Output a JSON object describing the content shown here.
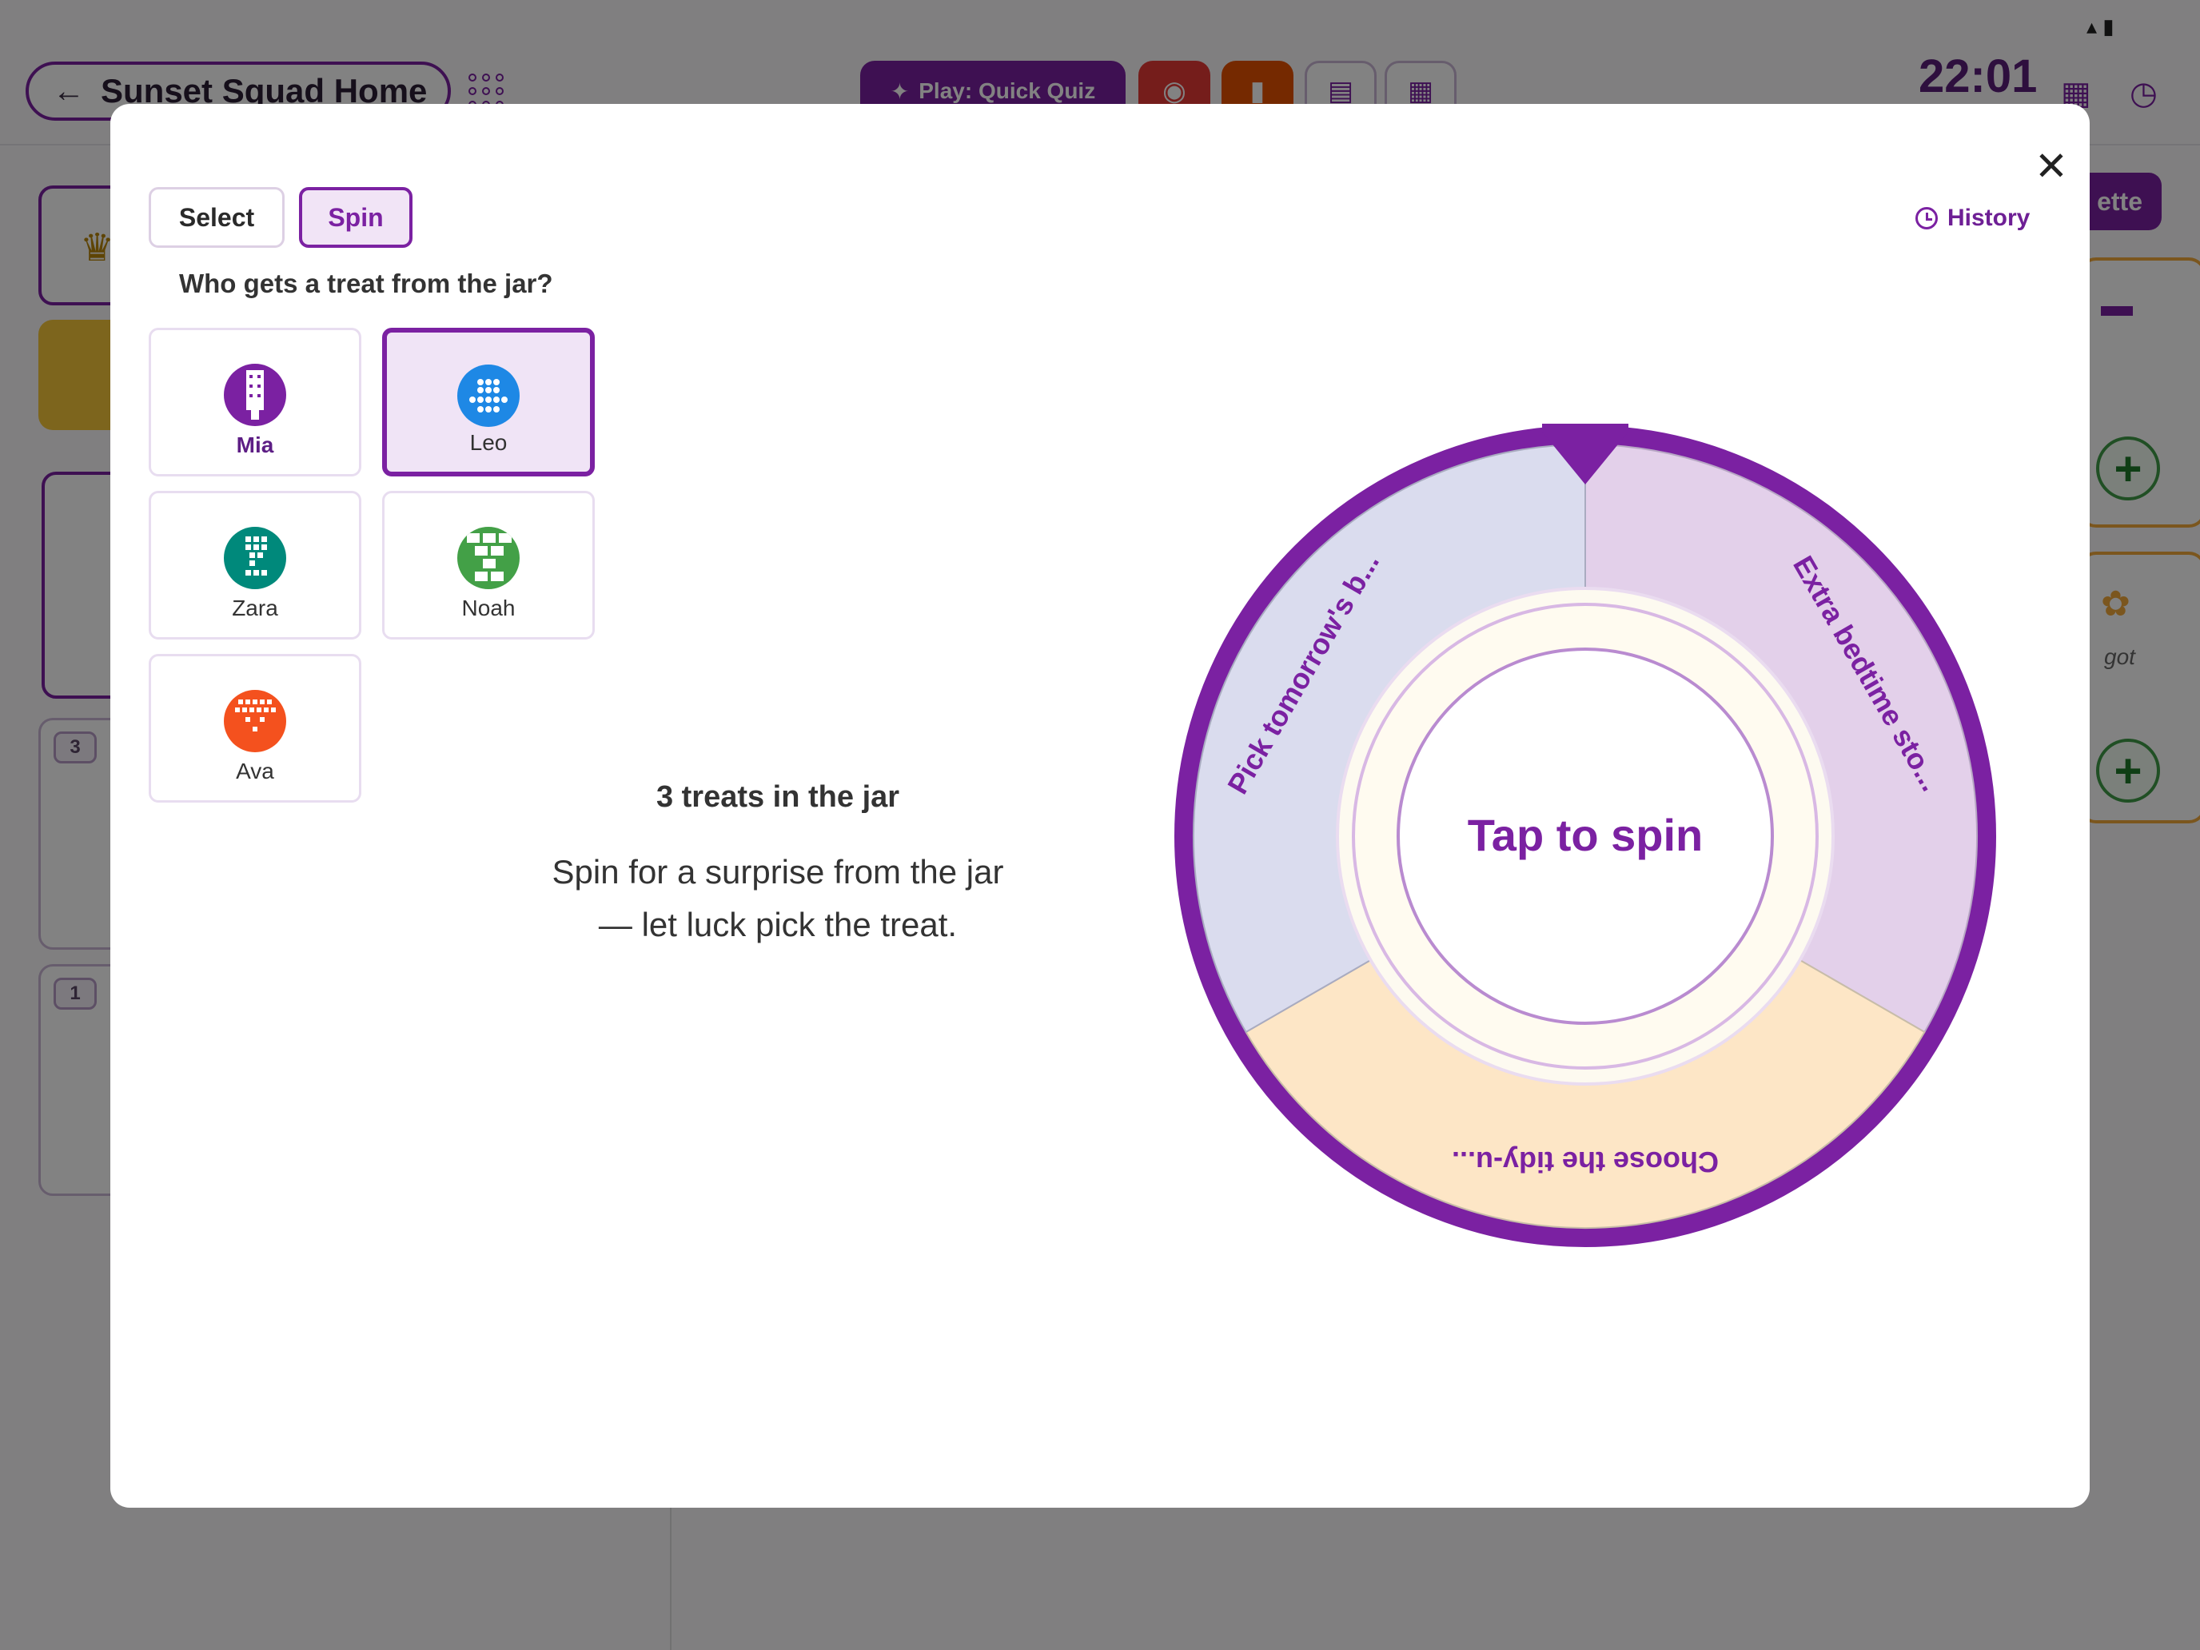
{
  "background": {
    "home_label": "Sunset Squad Home",
    "quiz_label": "Play: Quick Quiz",
    "time": "22:01",
    "palette_label": "ette",
    "side_badges": [
      "3",
      "1"
    ],
    "right_card_text": "got"
  },
  "modal": {
    "tabs": {
      "select": "Select",
      "spin": "Spin"
    },
    "history_label": "History",
    "question": "Who gets a treat from the jar?",
    "people": [
      {
        "name": "Mia",
        "color": "#7b21a2"
      },
      {
        "name": "Leo",
        "color": "#1e88e5"
      },
      {
        "name": "Zara",
        "color": "#00897b"
      },
      {
        "name": "Noah",
        "color": "#43a047"
      },
      {
        "name": "Ava",
        "color": "#f4511e"
      }
    ],
    "selected_person": "Leo",
    "count_text": "3 treats in the jar",
    "description_line1": "Spin for a surprise from the jar",
    "description_line2": "— let luck pick the treat.",
    "wheel": {
      "center_label": "Tap to spin",
      "segments": [
        {
          "label": "Extra bedtime sto...",
          "color": "#e3d0ea"
        },
        {
          "label": "Choose the tidy-u...",
          "color": "#fde6c6"
        },
        {
          "label": "Pick tomorrow's b...",
          "color": "#dadcee"
        }
      ],
      "accent": "#7b21a2"
    }
  }
}
